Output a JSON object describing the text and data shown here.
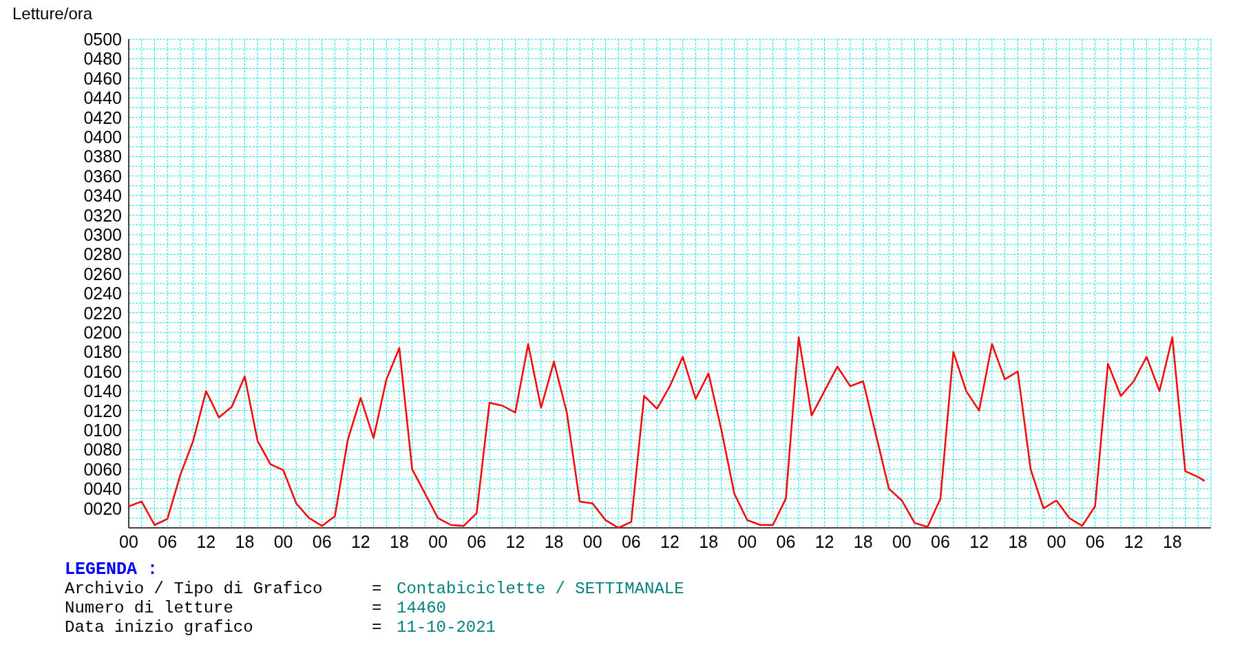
{
  "chart": {
    "chart_data": {
      "type": "line",
      "ylabel": "Letture/ora",
      "x": [
        0,
        2,
        4,
        6,
        8,
        10,
        12,
        14,
        16,
        18,
        20,
        22,
        24,
        26,
        28,
        30,
        32,
        34,
        36,
        38,
        40,
        42,
        44,
        46,
        48,
        50,
        52,
        54,
        56,
        58,
        60,
        62,
        64,
        66,
        68,
        70,
        72,
        74,
        76,
        78,
        80,
        82,
        84,
        86,
        88,
        90,
        92,
        94,
        96,
        98,
        100,
        102,
        104,
        106,
        108,
        110,
        112,
        114,
        116,
        118,
        120,
        122,
        124,
        126,
        128,
        130,
        132,
        134,
        136,
        138,
        140,
        142,
        144,
        146,
        148,
        150,
        152,
        154,
        156,
        158,
        160,
        162,
        164,
        166,
        167
      ],
      "series": [
        {
          "color": "#ff0000",
          "values": [
            22,
            27,
            3,
            9,
            54,
            89,
            140,
            113,
            124,
            155,
            89,
            65,
            59,
            25,
            10,
            2,
            12,
            90,
            133,
            92,
            152,
            184,
            60,
            35,
            10,
            3,
            2,
            15,
            128,
            125,
            118,
            188,
            123,
            170,
            118,
            27,
            25,
            8,
            0,
            6,
            135,
            122,
            145,
            175,
            132,
            158,
            100,
            35,
            8,
            3,
            3,
            30,
            195,
            115,
            140,
            165,
            145,
            150,
            95,
            40,
            28,
            5,
            1,
            30,
            180,
            140,
            120,
            188,
            152,
            160,
            60,
            20,
            28,
            10,
            2,
            22,
            168,
            135,
            150,
            175,
            140,
            195,
            58,
            52,
            48
          ]
        }
      ],
      "grid": true,
      "xlim": [
        0,
        168
      ],
      "ylim": [
        0,
        500
      ],
      "xticks": [
        {
          "value": 0,
          "label": "00"
        },
        {
          "value": 6,
          "label": "06"
        },
        {
          "value": 12,
          "label": "12"
        },
        {
          "value": 18,
          "label": "18"
        },
        {
          "value": 24,
          "label": "00"
        },
        {
          "value": 30,
          "label": "06"
        },
        {
          "value": 36,
          "label": "12"
        },
        {
          "value": 42,
          "label": "18"
        },
        {
          "value": 48,
          "label": "00"
        },
        {
          "value": 54,
          "label": "06"
        },
        {
          "value": 60,
          "label": "12"
        },
        {
          "value": 66,
          "label": "18"
        },
        {
          "value": 72,
          "label": "00"
        },
        {
          "value": 78,
          "label": "06"
        },
        {
          "value": 84,
          "label": "12"
        },
        {
          "value": 90,
          "label": "18"
        },
        {
          "value": 96,
          "label": "00"
        },
        {
          "value": 102,
          "label": "06"
        },
        {
          "value": 108,
          "label": "12"
        },
        {
          "value": 114,
          "label": "18"
        },
        {
          "value": 120,
          "label": "00"
        },
        {
          "value": 126,
          "label": "06"
        },
        {
          "value": 132,
          "label": "12"
        },
        {
          "value": 138,
          "label": "18"
        },
        {
          "value": 144,
          "label": "00"
        },
        {
          "value": 150,
          "label": "06"
        },
        {
          "value": 156,
          "label": "12"
        },
        {
          "value": 162,
          "label": "18"
        }
      ],
      "yticks": [
        {
          "value": 20,
          "label": "0020"
        },
        {
          "value": 40,
          "label": "0040"
        },
        {
          "value": 60,
          "label": "0060"
        },
        {
          "value": 80,
          "label": "0080"
        },
        {
          "value": 100,
          "label": "0100"
        },
        {
          "value": 120,
          "label": "0120"
        },
        {
          "value": 140,
          "label": "0140"
        },
        {
          "value": 160,
          "label": "0160"
        },
        {
          "value": 180,
          "label": "0180"
        },
        {
          "value": 200,
          "label": "0200"
        },
        {
          "value": 220,
          "label": "0220"
        },
        {
          "value": 240,
          "label": "0240"
        },
        {
          "value": 260,
          "label": "0260"
        },
        {
          "value": 280,
          "label": "0280"
        },
        {
          "value": 300,
          "label": "0300"
        },
        {
          "value": 320,
          "label": "0320"
        },
        {
          "value": 340,
          "label": "0340"
        },
        {
          "value": 360,
          "label": "0360"
        },
        {
          "value": 380,
          "label": "0380"
        },
        {
          "value": 400,
          "label": "0400"
        },
        {
          "value": 420,
          "label": "0420"
        },
        {
          "value": 440,
          "label": "0440"
        },
        {
          "value": 460,
          "label": "0460"
        },
        {
          "value": 480,
          "label": "0480"
        },
        {
          "value": 500,
          "label": "0500"
        }
      ]
    }
  },
  "legend": {
    "title": "LEGENDA :",
    "rows": [
      {
        "label": "Archivio / Tipo di Grafico",
        "separator": "=",
        "value": "Contabiciclette / SETTIMANALE"
      },
      {
        "label": "Numero di letture",
        "separator": "=",
        "value": "14460"
      },
      {
        "label": "Data inizio grafico",
        "separator": "=",
        "value": "11-10-2021"
      }
    ]
  }
}
